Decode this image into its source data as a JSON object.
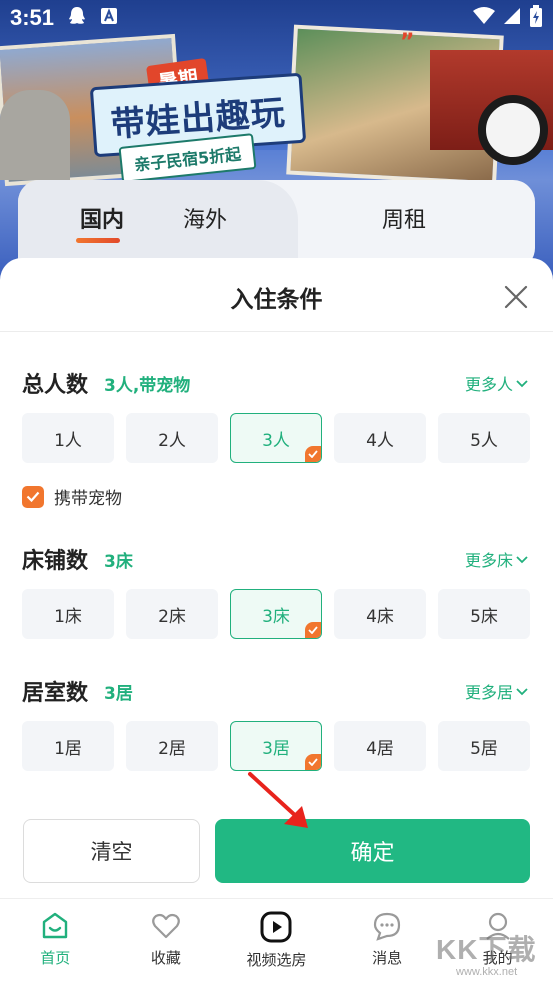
{
  "status_bar": {
    "time": "3:51"
  },
  "banner": {
    "tag": "暑期",
    "title": "带娃出趣玩",
    "subtitle": "亲子民宿5折起"
  },
  "tabs": [
    {
      "label": "国内",
      "active": true
    },
    {
      "label": "海外",
      "active": false
    },
    {
      "label": "周租",
      "active": false
    }
  ],
  "sheet": {
    "title": "入住条件",
    "guests": {
      "title": "总人数",
      "value": "3人,带宠物",
      "more": "更多人",
      "options": [
        "1人",
        "2人",
        "3人",
        "4人",
        "5人"
      ],
      "selected_index": 2,
      "pet_label": "携带宠物",
      "pet_checked": true
    },
    "beds": {
      "title": "床铺数",
      "value": "3床",
      "more": "更多床",
      "options": [
        "1床",
        "2床",
        "3床",
        "4床",
        "5床"
      ],
      "selected_index": 2
    },
    "rooms": {
      "title": "居室数",
      "value": "3居",
      "more": "更多居",
      "options": [
        "1居",
        "2居",
        "3居",
        "4居",
        "5居"
      ],
      "selected_index": 2
    },
    "clear_label": "清空",
    "confirm_label": "确定"
  },
  "nav": [
    {
      "label": "首页",
      "icon": "home-icon",
      "active": true
    },
    {
      "label": "收藏",
      "icon": "heart-icon",
      "active": false
    },
    {
      "label": "视频选房",
      "icon": "video-icon",
      "active": false
    },
    {
      "label": "消息",
      "icon": "message-icon",
      "active": false
    },
    {
      "label": "我的",
      "icon": "profile-icon",
      "active": false
    }
  ],
  "watermark": {
    "text": "KK下载",
    "url": "www.kkx.net"
  },
  "colors": {
    "accent_green": "#21b07d",
    "accent_orange": "#f1762e",
    "banner_blue": "#2a4d9c"
  }
}
